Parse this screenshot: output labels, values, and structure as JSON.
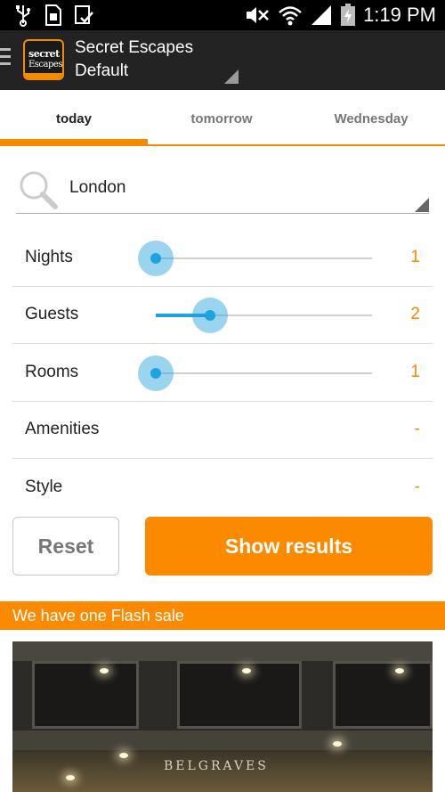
{
  "status_bar": {
    "time": "1:19 PM",
    "icons": [
      "usb-icon",
      "sim-card-icon",
      "download-done-icon",
      "mute-icon",
      "wifi-icon",
      "signal-icon",
      "battery-charging-icon"
    ]
  },
  "action_bar": {
    "logo_line1": "secret",
    "logo_line2": "Escapes",
    "title": "Secret Escapes",
    "subtitle": "Default"
  },
  "tabs": [
    {
      "label": "today",
      "active": true
    },
    {
      "label": "tomorrow",
      "active": false
    },
    {
      "label": "Wednesday",
      "active": false
    }
  ],
  "search": {
    "value": "London"
  },
  "filters": {
    "nights": {
      "label": "Nights",
      "value": "1",
      "slider_fraction": 0
    },
    "guests": {
      "label": "Guests",
      "value": "2",
      "slider_fraction": 0.25
    },
    "rooms": {
      "label": "Rooms",
      "value": "1",
      "slider_fraction": 0
    },
    "amenities": {
      "label": "Amenities",
      "value": "-"
    },
    "style": {
      "label": "Style",
      "value": "-"
    }
  },
  "buttons": {
    "reset": "Reset",
    "show_results": "Show results"
  },
  "flash_banner": "We have one Flash sale",
  "hotel": {
    "sign_text": "BELGRAVES"
  },
  "colors": {
    "accent": "#fb8a00",
    "slider": "#1ea3dc",
    "actionbar": "#232323"
  }
}
